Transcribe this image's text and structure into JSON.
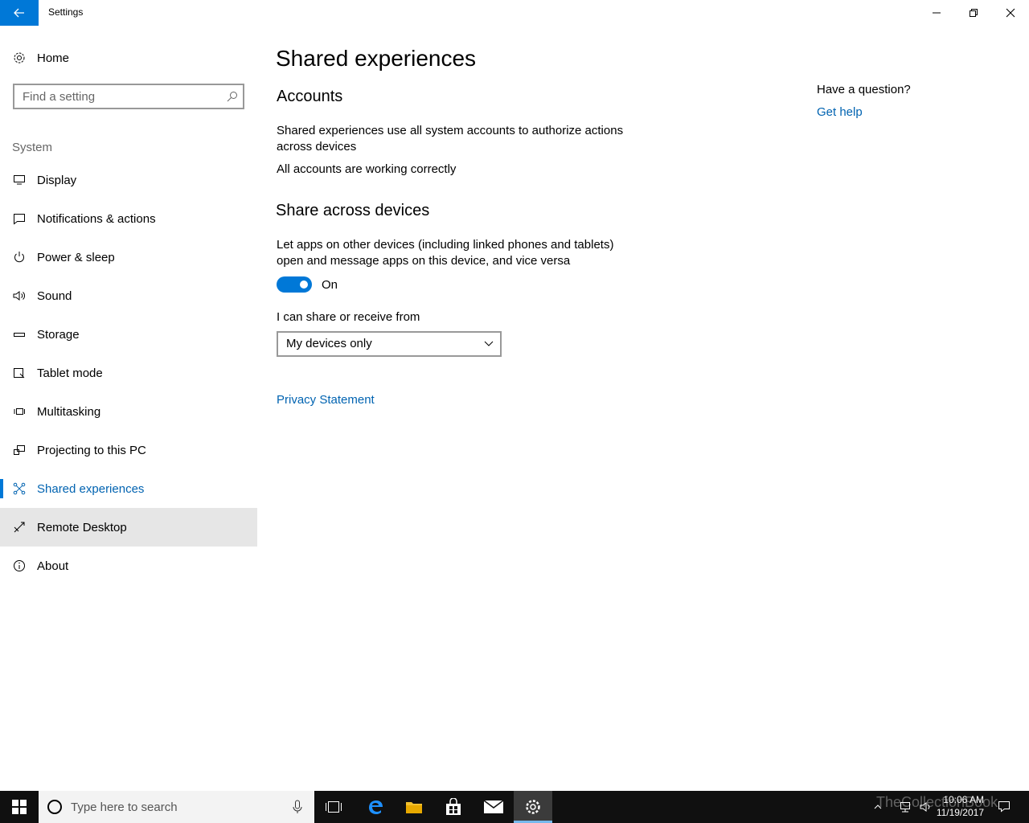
{
  "window": {
    "title": "Settings"
  },
  "sidebar": {
    "home_label": "Home",
    "search_placeholder": "Find a setting",
    "section_label": "System",
    "items": [
      {
        "label": "Display",
        "icon": "monitor-icon"
      },
      {
        "label": "Notifications & actions",
        "icon": "message-icon"
      },
      {
        "label": "Power & sleep",
        "icon": "power-icon"
      },
      {
        "label": "Sound",
        "icon": "speaker-icon"
      },
      {
        "label": "Storage",
        "icon": "storage-icon"
      },
      {
        "label": "Tablet mode",
        "icon": "tablet-icon"
      },
      {
        "label": "Multitasking",
        "icon": "multitask-icon"
      },
      {
        "label": "Projecting to this PC",
        "icon": "project-icon"
      },
      {
        "label": "Shared experiences",
        "icon": "shared-icon",
        "active": true
      },
      {
        "label": "Remote Desktop",
        "icon": "remote-icon",
        "hovered": true
      },
      {
        "label": "About",
        "icon": "info-icon"
      }
    ]
  },
  "main": {
    "title": "Shared experiences",
    "accounts": {
      "heading": "Accounts",
      "description": "Shared experiences use all system accounts to authorize actions across devices",
      "status": "All accounts are working correctly"
    },
    "share": {
      "heading": "Share across devices",
      "description": "Let apps on other devices (including linked phones and tablets) open and message apps on this device, and vice versa",
      "toggle_state": "On",
      "receive_label": "I can share or receive from",
      "dropdown_value": "My devices only"
    },
    "privacy_link": "Privacy Statement"
  },
  "help": {
    "question": "Have a question?",
    "link": "Get help"
  },
  "taskbar": {
    "search_placeholder": "Type here to search",
    "time": "10:06 AM",
    "date": "11/19/2017",
    "watermark": "TheCollectionBook"
  },
  "colors": {
    "accent": "#0078d7",
    "link": "#0063b1",
    "taskbar": "#101010"
  }
}
